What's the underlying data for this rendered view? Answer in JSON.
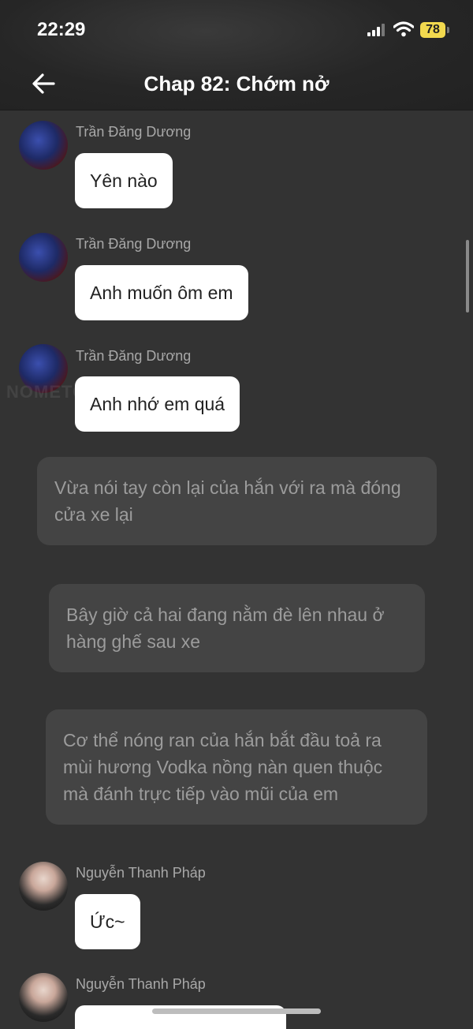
{
  "status_bar": {
    "time": "22:29",
    "battery": "78"
  },
  "header": {
    "title": "Chap 82: Chớm nở"
  },
  "watermark": "NOMETOON",
  "messages": [
    {
      "sender": "Trần Đăng Dương",
      "text": "Yên nào"
    },
    {
      "sender": "Trần Đăng Dương",
      "text": "Anh muốn ôm em"
    },
    {
      "sender": "Trần Đăng Dương",
      "text": "Anh nhớ em quá"
    },
    {
      "sender": "Nguyễn Thanh Pháp",
      "text": "Ức~"
    },
    {
      "sender": "Nguyễn Thanh Pháp",
      "text": ""
    }
  ],
  "narrations": [
    {
      "text": "Vừa nói tay còn lại của hắn với ra mà đóng cửa xe lại"
    },
    {
      "text": "Bây giờ cả hai đang nằm đè lên nhau ở hàng ghế sau xe"
    },
    {
      "text": "Cơ thể nóng ran của hắn bắt đầu toả ra mùi hương Vodka nồng nàn quen thuộc mà đánh trực tiếp vào mũi của em"
    }
  ]
}
